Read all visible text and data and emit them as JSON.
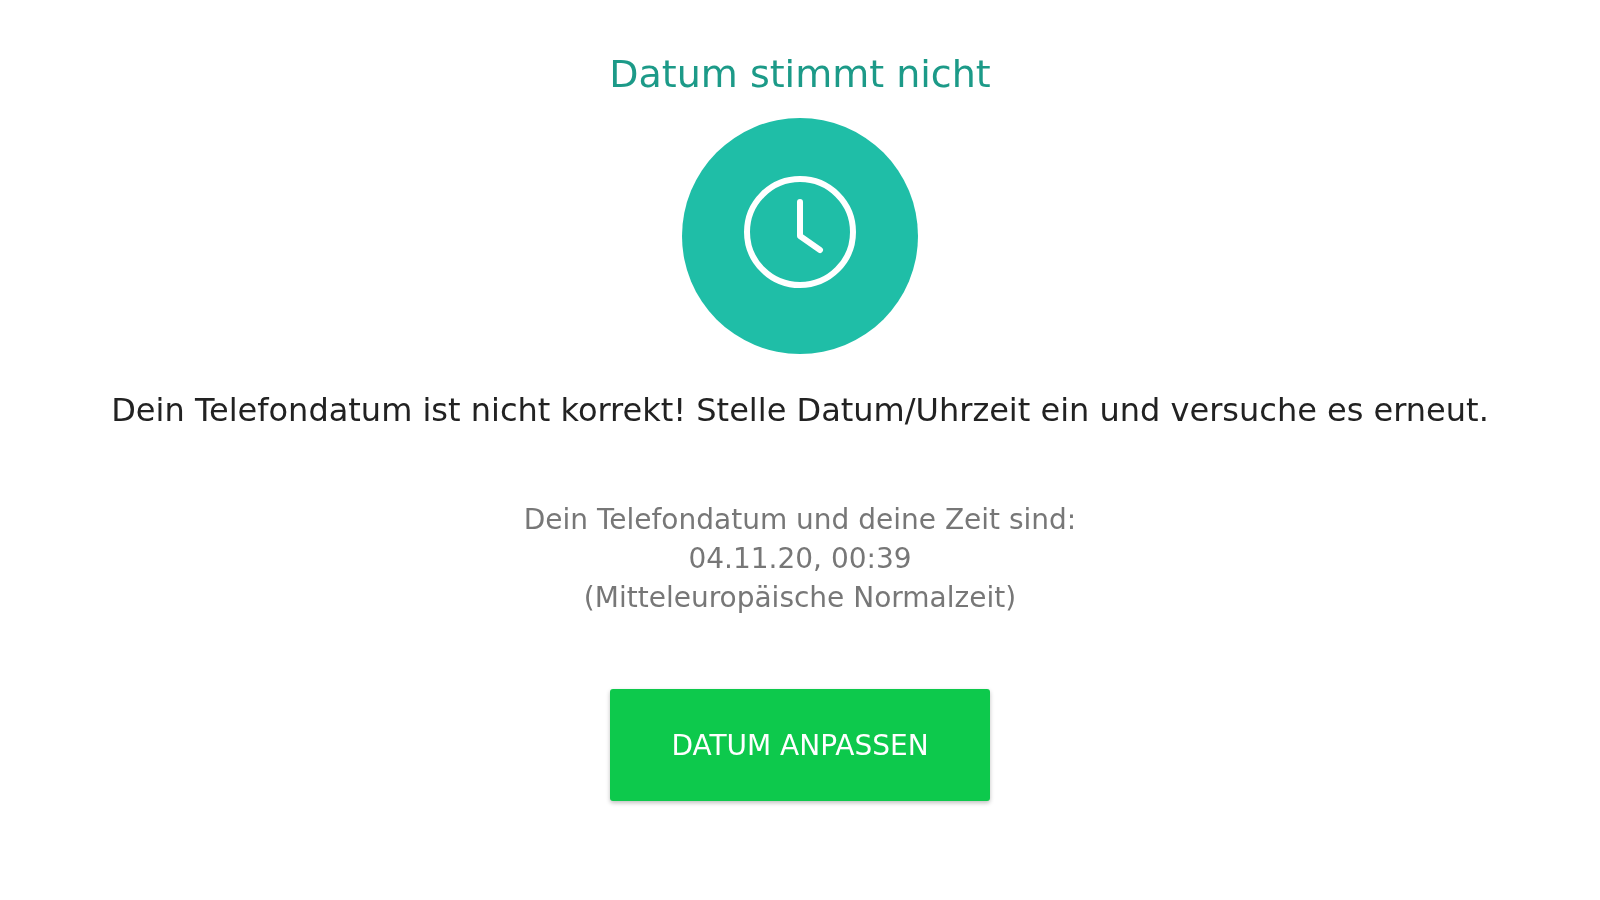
{
  "title": "Datum stimmt nicht",
  "message": "Dein Telefondatum ist nicht korrekt! Stelle Datum/Uhrzeit ein und versuche es erneut.",
  "info_lines": [
    "Dein Telefondatum und deine Zeit sind:",
    "04.11.20, 00:39",
    "(Mitteleuropäische Normalzeit)"
  ],
  "button": "DATUM ANPASSEN"
}
